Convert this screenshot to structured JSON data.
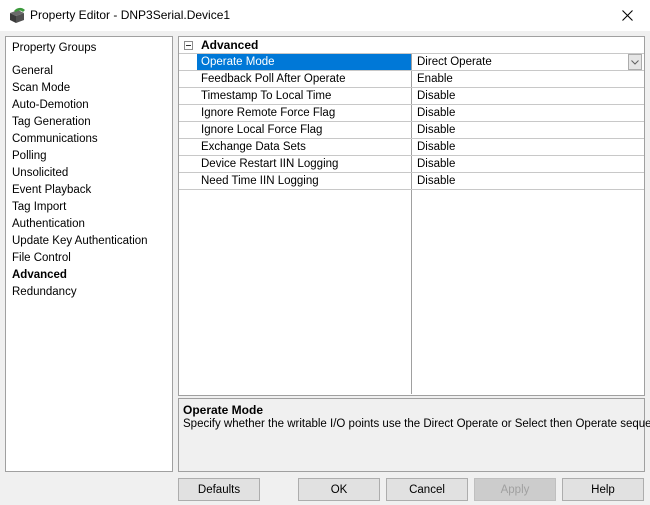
{
  "window": {
    "title": "Property Editor - DNP3Serial.Device1",
    "icon": "property-editor-app-icon",
    "close_icon": "close-icon"
  },
  "groups": {
    "header": "Property Groups",
    "items": [
      {
        "label": "General",
        "active": false
      },
      {
        "label": "Scan Mode",
        "active": false
      },
      {
        "label": "Auto-Demotion",
        "active": false
      },
      {
        "label": "Tag Generation",
        "active": false
      },
      {
        "label": "Communications",
        "active": false
      },
      {
        "label": "Polling",
        "active": false
      },
      {
        "label": "Unsolicited",
        "active": false
      },
      {
        "label": "Event Playback",
        "active": false
      },
      {
        "label": "Tag Import",
        "active": false
      },
      {
        "label": "Authentication",
        "active": false
      },
      {
        "label": "Update Key Authentication",
        "active": false
      },
      {
        "label": "File Control",
        "active": false
      },
      {
        "label": "Advanced",
        "active": true
      },
      {
        "label": "Redundancy",
        "active": false
      }
    ]
  },
  "grid": {
    "category": "Advanced",
    "category_state": "expanded",
    "selected_index": 0,
    "selection_color": "#0078d7",
    "properties": [
      {
        "name": "Operate Mode",
        "value": "Direct Operate",
        "has_dropdown": true
      },
      {
        "name": "Feedback Poll After Operate",
        "value": "Enable"
      },
      {
        "name": "Timestamp To Local Time",
        "value": "Disable"
      },
      {
        "name": "Ignore Remote Force Flag",
        "value": "Disable"
      },
      {
        "name": "Ignore Local Force Flag",
        "value": "Disable"
      },
      {
        "name": "Exchange Data Sets",
        "value": "Disable"
      },
      {
        "name": "Device Restart IIN Logging",
        "value": "Disable"
      },
      {
        "name": "Need Time IIN Logging",
        "value": "Disable"
      }
    ]
  },
  "description": {
    "title": "Operate Mode",
    "text": "Specify whether the writable I/O points use the Direct Operate or Select then Operate sequence."
  },
  "buttons": {
    "defaults": "Defaults",
    "ok": "OK",
    "cancel": "Cancel",
    "apply": "Apply",
    "apply_enabled": false,
    "help": "Help"
  }
}
